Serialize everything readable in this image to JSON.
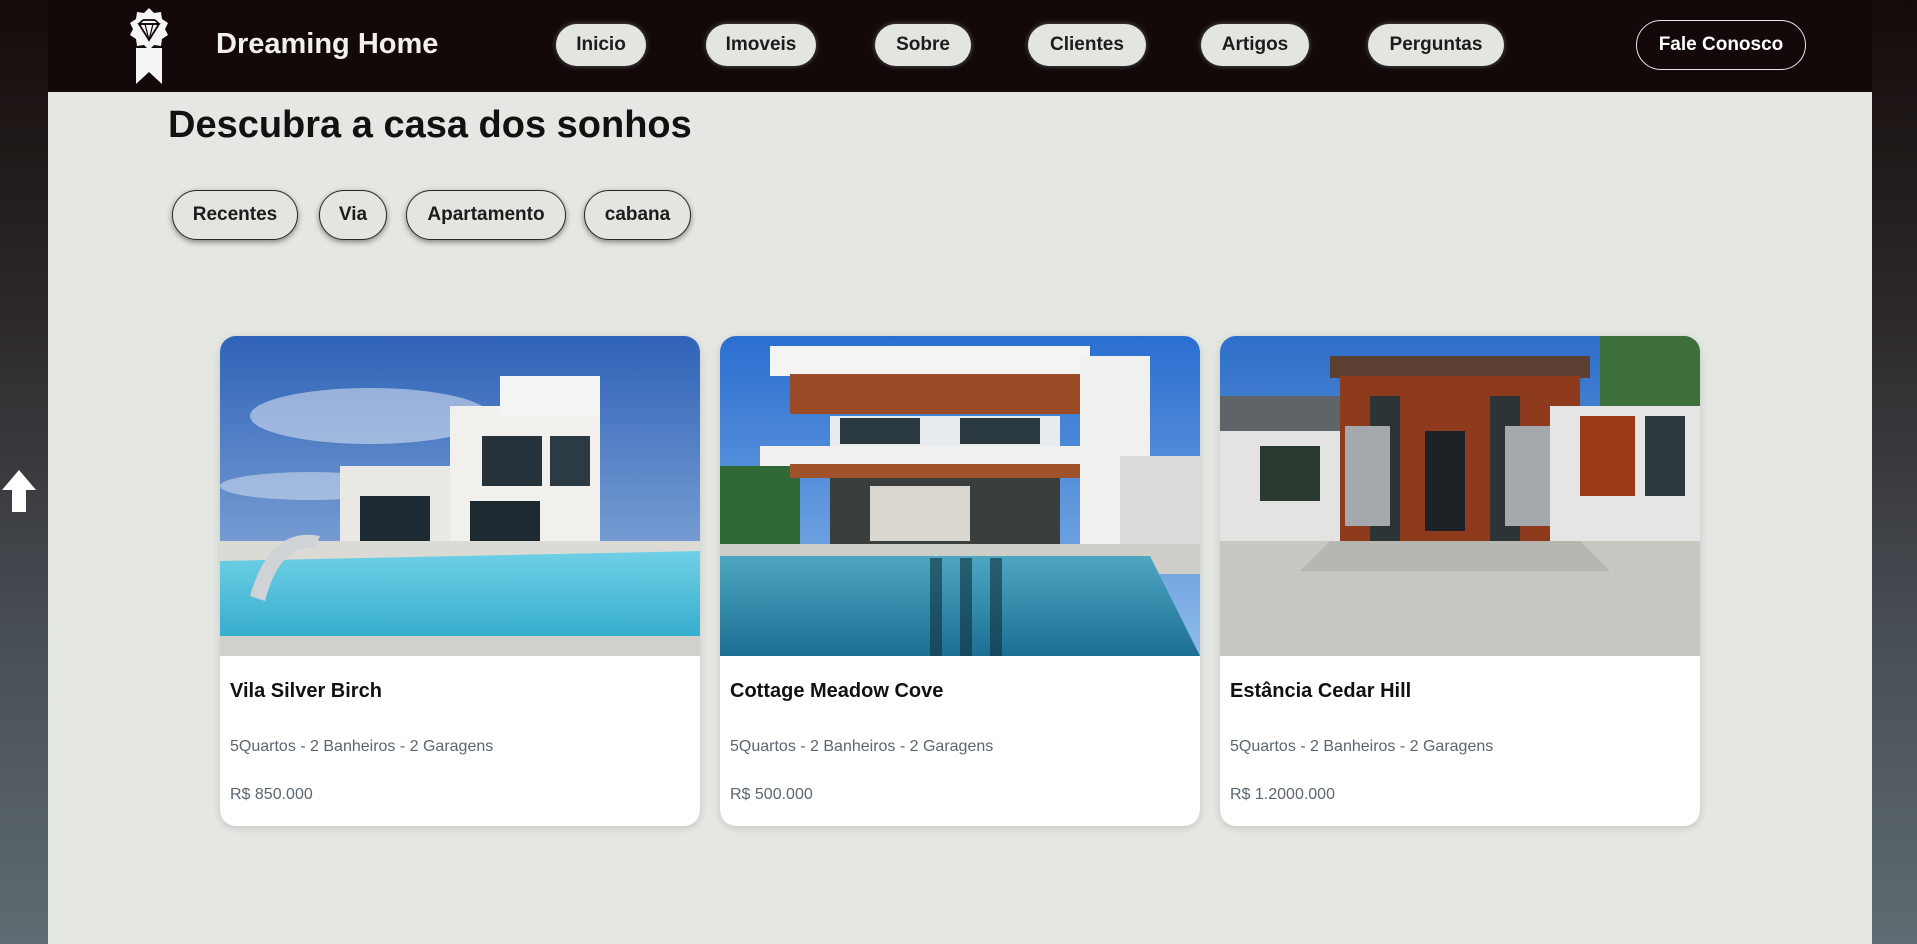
{
  "header": {
    "brand": "Dreaming Home",
    "logo_icon": "diamond-award-ribbon-icon",
    "nav": [
      "Inicio",
      "Imoveis",
      "Sobre",
      "Clientes",
      "Artigos",
      "Perguntas"
    ],
    "cta_label": "Fale Conosco"
  },
  "main": {
    "title": "Descubra a casa dos sonhos",
    "filters": [
      "Recentes",
      "Via",
      "Apartamento",
      "cabana"
    ],
    "listings": [
      {
        "title": "Vila Silver Birch",
        "specs": "5Quartos - 2 Banheiros - 2 Garagens",
        "price": "R$ 850.000",
        "image": "modern-white-villa-with-pool-photo"
      },
      {
        "title": "Cottage Meadow Cove",
        "specs": "5Quartos - 2 Banheiros - 2 Garagens",
        "price": "R$ 500.000",
        "image": "modern-house-with-wood-ceiling-and-pool-photo"
      },
      {
        "title": "Estância Cedar Hill",
        "specs": "5Quartos - 2 Banheiros - 2 Garagens",
        "price": "R$ 1.2000.000",
        "image": "house-with-wood-facade-and-driveway-photo"
      }
    ]
  },
  "scroll_top_icon": "arrow-up-icon",
  "colors": {
    "header_bg": "#120908",
    "main_bg": "#e5e7e2",
    "pill_bg": "#e3e5df",
    "muted_text": "#5a6670"
  }
}
